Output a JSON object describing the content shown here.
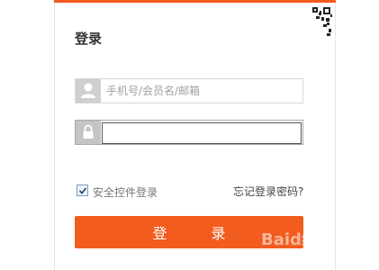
{
  "login": {
    "title": "登录",
    "username": {
      "placeholder": "手机号/会员名/邮箱"
    },
    "password": {
      "value": ""
    },
    "security_control": {
      "label": "安全控件登录",
      "checked": true
    },
    "forgot_password": "忘记登录密码?",
    "submit": "登 录"
  },
  "watermark": "Baid经验",
  "colors": {
    "accent": "#f25c1e",
    "icon_bg": "#cfcfcf"
  }
}
